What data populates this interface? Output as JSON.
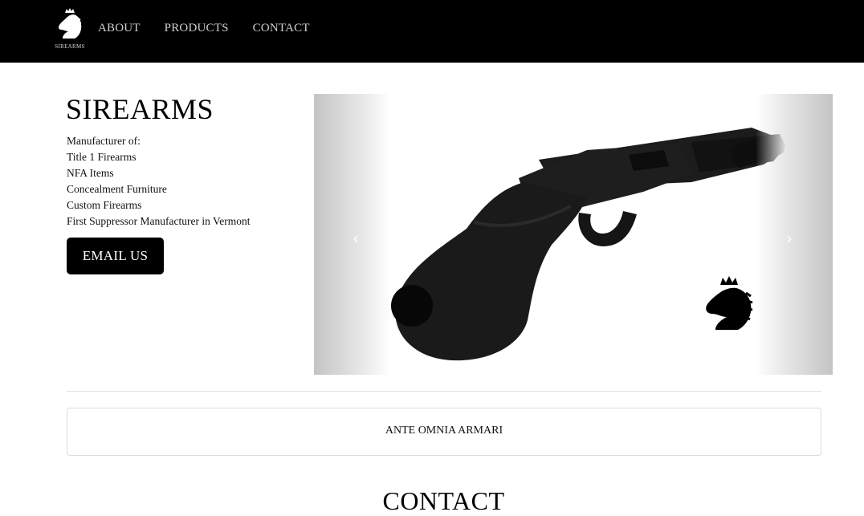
{
  "nav": {
    "logo_text": "SIREARMS",
    "links": [
      "ABOUT",
      "PRODUCTS",
      "CONTACT"
    ]
  },
  "hero": {
    "title": "SIREARMS",
    "features": [
      "Manufacturer of:",
      "Title 1 Firearms",
      "NFA Items",
      "Concealment Furniture",
      "Custom Firearms",
      "First Suppressor Manufacturer in Vermont"
    ],
    "email_button": "EMAIL US"
  },
  "carousel": {
    "prev_icon": "‹",
    "next_icon": "›",
    "image": "pistol-grip-shotgun",
    "overlay_logo": "knight-crown-logo"
  },
  "motto": "ANTE OMNIA ARMARI",
  "contact_heading": "CONTACT",
  "colors": {
    "navbar": "#000000",
    "nav_link": "#cfcfcf",
    "button_bg": "#000000",
    "button_text": "#ffffff"
  }
}
